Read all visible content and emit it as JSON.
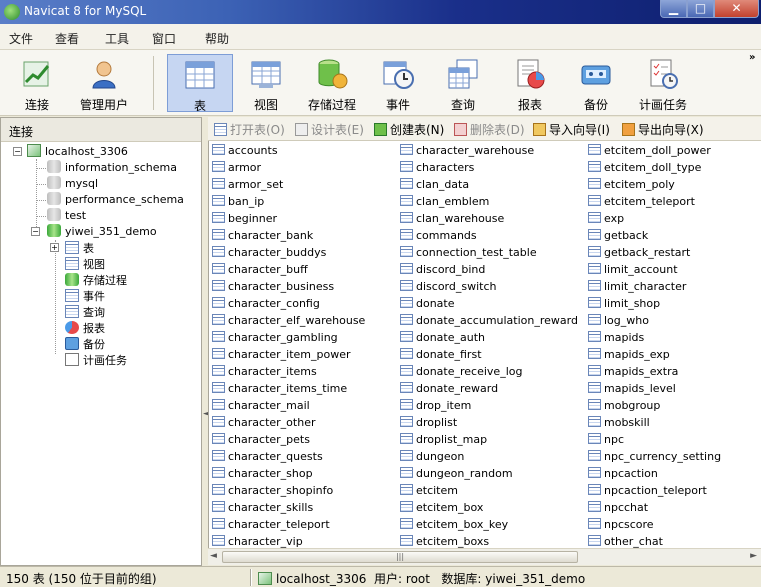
{
  "window": {
    "title": "Navicat 8 for MySQL",
    "min": "▁",
    "max": "□",
    "close": "✕"
  },
  "menu": [
    "文件",
    "查看",
    "工具",
    "窗口",
    "帮助"
  ],
  "toolbar": [
    {
      "label": "连接",
      "icon": "connect-icon"
    },
    {
      "label": "管理用户",
      "icon": "user-icon"
    },
    {
      "label": "表",
      "icon": "table-icon",
      "active": true
    },
    {
      "label": "视图",
      "icon": "view-icon"
    },
    {
      "label": "存储过程",
      "icon": "procedure-icon"
    },
    {
      "label": "事件",
      "icon": "event-icon"
    },
    {
      "label": "查询",
      "icon": "query-icon"
    },
    {
      "label": "报表",
      "icon": "report-icon"
    },
    {
      "label": "备份",
      "icon": "backup-icon"
    },
    {
      "label": "计画任务",
      "icon": "schedule-icon"
    }
  ],
  "toolbar_overflow": "»",
  "sidebar": {
    "header": "连接",
    "connection": "localhost_3306",
    "databases": [
      "information_schema",
      "mysql",
      "performance_schema",
      "test",
      "yiwei_351_demo"
    ],
    "children": [
      "表",
      "视图",
      "存储过程",
      "事件",
      "查询",
      "报表",
      "备份",
      "计画任务"
    ]
  },
  "objbar": [
    {
      "label": "打开表(O)",
      "enabled": false
    },
    {
      "label": "设计表(E)",
      "enabled": false
    },
    {
      "label": "创建表(N)",
      "enabled": true
    },
    {
      "label": "删除表(D)",
      "enabled": false
    },
    {
      "label": "导入向导(I)",
      "enabled": true
    },
    {
      "label": "导出向导(X)",
      "enabled": true
    }
  ],
  "tables": {
    "col1": [
      "accounts",
      "armor",
      "armor_set",
      "ban_ip",
      "beginner",
      "character_bank",
      "character_buddys",
      "character_buff",
      "character_business",
      "character_config",
      "character_elf_warehouse",
      "character_gambling",
      "character_item_power",
      "character_items",
      "character_items_time",
      "character_mail",
      "character_other",
      "character_pets",
      "character_quests",
      "character_shop",
      "character_shopinfo",
      "character_skills",
      "character_teleport",
      "character_vip"
    ],
    "col2": [
      "character_warehouse",
      "characters",
      "clan_data",
      "clan_emblem",
      "clan_warehouse",
      "commands",
      "connection_test_table",
      "discord_bind",
      "discord_switch",
      "donate",
      "donate_accumulation_reward",
      "donate_auth",
      "donate_first",
      "donate_receive_log",
      "donate_reward",
      "drop_item",
      "droplist",
      "droplist_map",
      "dungeon",
      "dungeon_random",
      "etcitem",
      "etcitem_box",
      "etcitem_box_key",
      "etcitem_boxs"
    ],
    "col3": [
      "etcitem_doll_power",
      "etcitem_doll_type",
      "etcitem_poly",
      "etcitem_teleport",
      "exp",
      "getback",
      "getback_restart",
      "limit_account",
      "limit_character",
      "limit_shop",
      "log_who",
      "mapids",
      "mapids_exp",
      "mapids_extra",
      "mapids_level",
      "mobgroup",
      "mobskill",
      "npc",
      "npc_currency_setting",
      "npcaction",
      "npcaction_teleport",
      "npcchat",
      "npcscore",
      "other_chat"
    ]
  },
  "scroll": {
    "left": "◄",
    "right": "►",
    "grip": "|||",
    "splitter_grip": "◄"
  },
  "status": {
    "count": "150 表 (150 位于目前的组)",
    "connection": "localhost_3306",
    "user": "用户: root",
    "database": "数据库: yiwei_351_demo"
  }
}
